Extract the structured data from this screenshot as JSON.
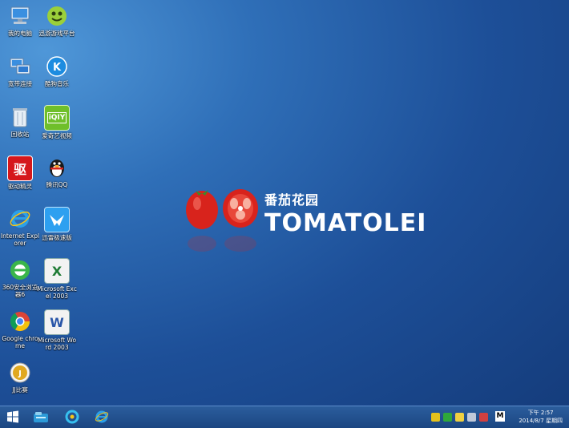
{
  "desktop_icons": [
    {
      "label": "我的电脑",
      "icon": "computer-icon"
    },
    {
      "label": "迅游游戏平台",
      "icon": "game-platform-icon"
    },
    {
      "label": "宽带连接",
      "icon": "network-connection-icon"
    },
    {
      "label": "酷狗音乐",
      "icon": "kugou-music-icon"
    },
    {
      "label": "回收站",
      "icon": "recycle-bin-icon"
    },
    {
      "label": "爱奇艺视频",
      "icon": "iqiyi-video-icon"
    },
    {
      "label": "驱动精灵",
      "icon": "driver-genius-icon"
    },
    {
      "label": "腾讯QQ",
      "icon": "qq-penguin-icon"
    },
    {
      "label": "Internet Explorer",
      "icon": "internet-explorer-icon"
    },
    {
      "label": "迅雷极速版",
      "icon": "xunlei-thunder-icon"
    },
    {
      "label": "360安全浏览器6",
      "icon": "360-browser-icon"
    },
    {
      "label": "Microsoft Excel 2003",
      "icon": "excel-icon"
    },
    {
      "label": "Google chrome",
      "icon": "chrome-icon"
    },
    {
      "label": "Microsoft Word 2003",
      "icon": "word-icon"
    },
    {
      "label": "JJ比赛",
      "icon": "jj-game-icon"
    }
  ],
  "wallpaper": {
    "brand_cn": "番茄花园",
    "brand_en": "TOMATOLEI"
  },
  "taskbar": {
    "pinned": [
      "start-icon",
      "file-explorer-icon",
      "qq-browser-icon",
      "internet-explorer-icon"
    ],
    "tray_letter": "M",
    "clock_time": "下午 2:57",
    "clock_date": "2014/8/7 星期四"
  },
  "colors": {
    "desktop_blue": "#1d4f98",
    "taskbar_blue": "#1b4682",
    "tomato_red": "#d8231c"
  }
}
